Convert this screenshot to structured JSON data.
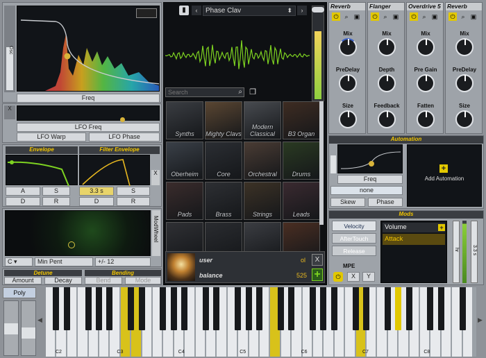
{
  "osc": {
    "side_tab": "Osc",
    "freq_label": "Freq",
    "x_label": "X"
  },
  "lfo": {
    "freq_label": "LFO Freq",
    "warp_label": "LFO Warp",
    "phase_label": "LFO Phase"
  },
  "envelope": {
    "title": "Envelope",
    "a": "A",
    "s": "S",
    "d": "D",
    "r": "R"
  },
  "filter_envelope": {
    "title": "Filter Envelope",
    "a_value": "3.3 s",
    "s": "S",
    "d": "D",
    "r": "R"
  },
  "modwheel": {
    "side_label": "ModWheel",
    "c_label": "C",
    "min_label": "Min Pent",
    "range_label": "+/- 12"
  },
  "detune": {
    "title": "Detune",
    "amount": "Amount",
    "decay": "Decay"
  },
  "bending": {
    "title": "Bending",
    "left": "Bend",
    "right": "Mode"
  },
  "poly_label": "Poly",
  "preset": {
    "name": "Phase Clav",
    "search_placeholder": "Search"
  },
  "browser": {
    "tiles": [
      "Synths",
      "Mighty Clavs",
      "Modern Classical",
      "B3 Organ",
      "Oberheim",
      "Core",
      "Orchestral",
      "Drums",
      "Pads",
      "Brass",
      "Strings",
      "Leads",
      "",
      "",
      "",
      ""
    ]
  },
  "user": {
    "user_label": "user",
    "user_value": "ol",
    "balance_label": "balance",
    "balance_value": "525",
    "close": "X",
    "add": "+"
  },
  "effects": [
    {
      "name": "Reverb",
      "knobs": [
        "Mix",
        "PreDelay",
        "Size"
      ]
    },
    {
      "name": "Flanger",
      "knobs": [
        "Mix",
        "Depth",
        "Feedback"
      ]
    },
    {
      "name": "Overdrive 5",
      "knobs": [
        "Mix",
        "Pre Gain",
        "Fatten"
      ]
    },
    {
      "name": "Reverb",
      "knobs": [
        "Mix",
        "PreDelay",
        "Size"
      ]
    }
  ],
  "automation": {
    "title": "Automation",
    "freq_label": "Freq",
    "source": "none",
    "skew": "Skew",
    "phase": "Phase",
    "add_label": "Add Automation"
  },
  "mods": {
    "title": "Mods",
    "velocity": "Velocity",
    "aftertouch": "AfterTouch",
    "release": "Release",
    "slots": [
      "Volume",
      "Attack"
    ],
    "mpe": "MPE",
    "x": "X",
    "y": "Y",
    "meter1": "hr",
    "meter2": "3.3 s"
  },
  "keyboard": {
    "octaves": [
      "C2",
      "C3",
      "C4",
      "C5",
      "C6",
      "C7",
      "C8"
    ],
    "left_arrow": "◀",
    "right_arrow": "▶"
  },
  "colors": {
    "accent": "#f2c500",
    "green": "#7ed321",
    "blue": "#3f64c8"
  }
}
